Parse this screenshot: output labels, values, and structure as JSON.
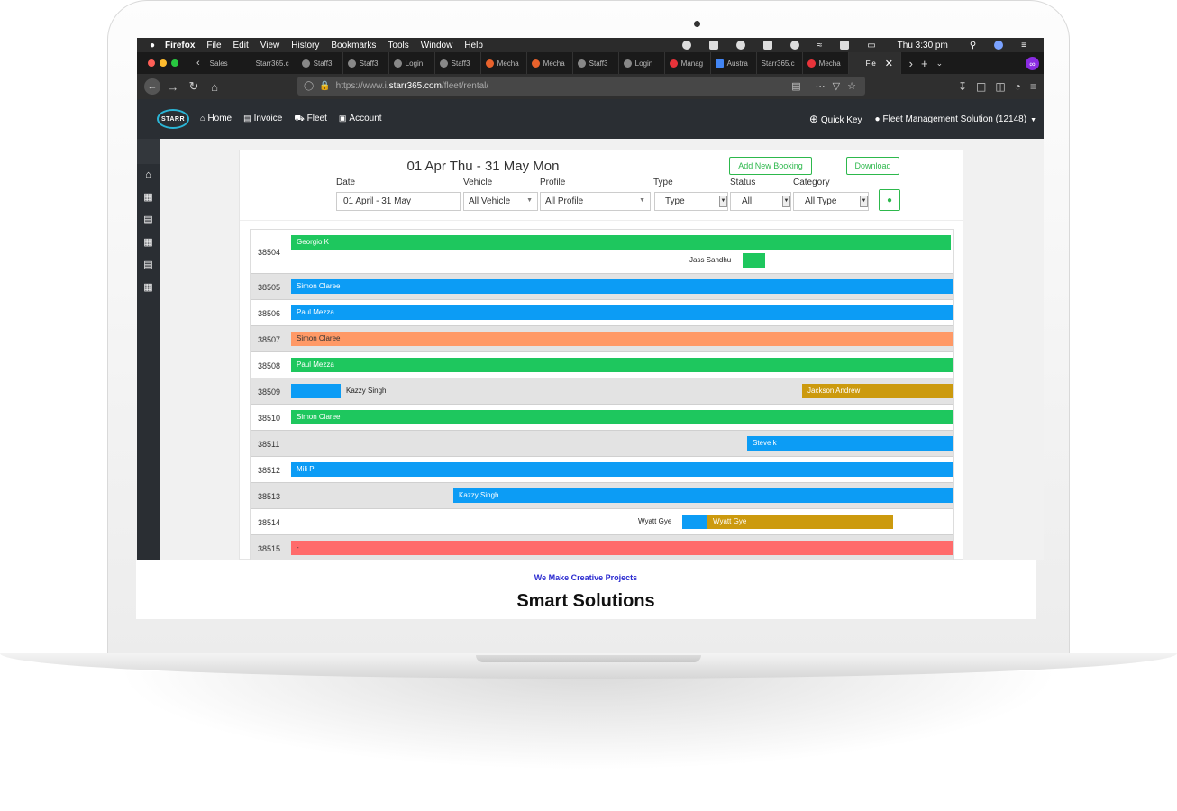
{
  "mac_menu": {
    "app": "Firefox",
    "items": [
      "File",
      "Edit",
      "View",
      "History",
      "Bookmarks",
      "Tools",
      "Window",
      "Help"
    ],
    "clock": "Thu 3:30 pm"
  },
  "tabs": [
    "Sales",
    "Starr365.c",
    "Staff3",
    "Staff3",
    "Login",
    "Staff3",
    "Mecha",
    "Mecha",
    "Staff3",
    "Login",
    "Manag",
    "Austra",
    "Starr365.c",
    "Mecha",
    "Fle"
  ],
  "browser": {
    "url_prefix": "https://www.i.",
    "url_domain": "starr365.com",
    "url_path": "/fleet/rental/"
  },
  "app_header": {
    "logo_text": "STARR",
    "nav": [
      "Home",
      "Invoice",
      "Fleet",
      "Account"
    ],
    "quick_key": "Quick Key",
    "account": "Fleet Management Solution (12148)"
  },
  "filters": {
    "title": "01 Apr Thu - 31 May Mon",
    "add_booking": "Add New Booking",
    "download": "Download",
    "date_label": "Date",
    "date_value": "01 April  - 31 May",
    "vehicle_label": "Vehicle",
    "vehicle_value": "All Vehicle",
    "profile_label": "Profile",
    "profile_value": "All Profile",
    "type_label": "Type",
    "type_value": "Type",
    "status_label": "Status",
    "status_value": "All",
    "category_label": "Category",
    "category_value": "All Type"
  },
  "rows": [
    {
      "id": "38504",
      "bookings": [
        {
          "name": "Georgio K",
          "color": "#1ec75e"
        },
        {
          "name": "Jass Sandhu",
          "color": "#1ec75e"
        }
      ]
    },
    {
      "id": "38505",
      "bookings": [
        {
          "name": "Simon Claree",
          "color": "#0c9cf5"
        }
      ]
    },
    {
      "id": "38506",
      "bookings": [
        {
          "name": "Paul Mezza",
          "color": "#0c9cf5"
        }
      ]
    },
    {
      "id": "38507",
      "bookings": [
        {
          "name": "Simon Claree",
          "color": "#ff9966"
        }
      ]
    },
    {
      "id": "38508",
      "bookings": [
        {
          "name": "Paul Mezza",
          "color": "#1ec75e"
        }
      ]
    },
    {
      "id": "38509",
      "bookings": [
        {
          "name": "Kazzy Singh",
          "color": "#0c9cf5"
        },
        {
          "name": "Jackson Andrew",
          "color": "#cc9a0e"
        }
      ]
    },
    {
      "id": "38510",
      "bookings": [
        {
          "name": "Simon Claree",
          "color": "#1ec75e"
        }
      ]
    },
    {
      "id": "38511",
      "bookings": [
        {
          "name": "Steve k",
          "color": "#0c9cf5"
        }
      ]
    },
    {
      "id": "38512",
      "bookings": [
        {
          "name": "Mili P",
          "color": "#0c9cf5"
        }
      ]
    },
    {
      "id": "38513",
      "bookings": [
        {
          "name": "Kazzy Singh",
          "color": "#0c9cf5"
        }
      ]
    },
    {
      "id": "38514",
      "bookings": [
        {
          "name": "Wyatt Gye",
          "color": "#0c9cf5"
        },
        {
          "name": "Wyatt Gye",
          "color": "#cc9a0e"
        }
      ]
    },
    {
      "id": "38515",
      "bookings": [
        {
          "name": "-",
          "color": "#ff6b6b"
        }
      ]
    }
  ],
  "caption": {
    "small": "We Make Creative Projects",
    "big": "Smart Solutions"
  }
}
